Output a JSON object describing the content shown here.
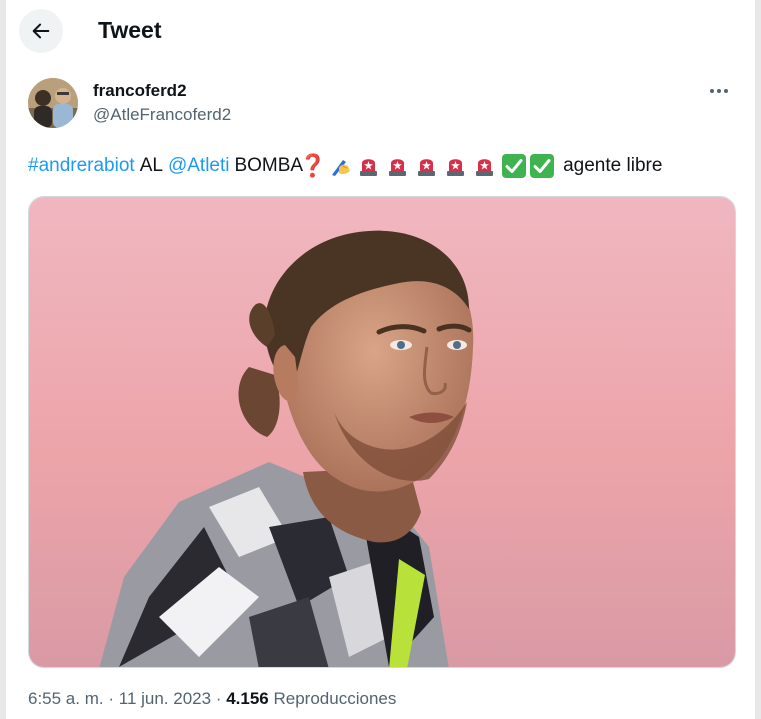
{
  "header": {
    "title": "Tweet",
    "back_icon": "arrow-left-icon"
  },
  "author": {
    "display_name": "francoferd2",
    "handle": "@AtleFrancoferd2"
  },
  "tweet": {
    "hashtag": "#andrerabiot",
    "text_al": "AL",
    "mention": "@Atleti",
    "text_bomba": "BOMBA",
    "question_emoji": "❓",
    "writing_hand_emoji": "✍️",
    "siren_emoji_count": 5,
    "check_emoji_count": 2,
    "text_end": "agente libre"
  },
  "meta": {
    "time": "6:55 a. m.",
    "sep1": "·",
    "date": "11 jun. 2023",
    "sep2": "·",
    "views": "4.156",
    "views_label": "Reproducciones"
  },
  "colors": {
    "link": "#1d9bf0",
    "secondary_text": "#536471",
    "primary_text": "#0f1419",
    "check_emoji": "#3eb34f",
    "siren_emoji": "#d6314a"
  }
}
